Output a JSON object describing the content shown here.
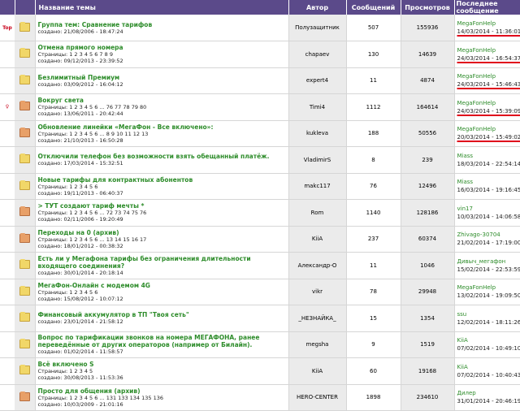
{
  "header": {
    "title": "Название темы",
    "author": "Автор",
    "messages": "Сообщений",
    "views": "Просмотров",
    "last": "Последнее сообщение"
  },
  "rows": [
    {
      "mark": "Top",
      "icon": "folder-special-icon",
      "title": "Группа тем: Сравнение тарифов",
      "pages": "",
      "created": "создано: 21/08/2006 - 18:47:24",
      "author": "Полузащитник",
      "messages": "507",
      "views": "155936",
      "last_user": "MegaFonHelp",
      "last_date": "14/03/2014 - 11:36:01"
    },
    {
      "mark": "",
      "icon": "folder-icon",
      "title": "Отмена прямого номера",
      "pages": "Страницы: 1 2 3 4 5 6 7 8 9",
      "created": "создано: 09/12/2013 - 23:39:52",
      "author": "chapaev",
      "messages": "130",
      "views": "14639",
      "last_user": "MegaFonHelp",
      "last_date": "24/03/2014 - 16:54:37"
    },
    {
      "mark": "",
      "icon": "folder-icon",
      "title": "Безлимитный Премиум",
      "pages": "",
      "created": "создано: 03/09/2012 - 16:04:12",
      "author": "expert4",
      "messages": "11",
      "views": "4874",
      "last_user": "MegaFonHelp",
      "last_date": "24/03/2014 - 15:46:43"
    },
    {
      "mark": "♀",
      "icon": "folder-hot-icon",
      "title": "Вокруг света",
      "pages": "Страницы: 1 2 3 4 5 6 ... 76 77 78 79 80",
      "created": "создано: 13/06/2011 - 20:42:44",
      "author": "Timi4",
      "messages": "1112",
      "views": "164614",
      "last_user": "MegaFonHelp",
      "last_date": "24/03/2014 - 15:39:09"
    },
    {
      "mark": "",
      "icon": "folder-hot-icon",
      "title": "Обновление линейки «МегаФон - Все включено»:",
      "pages": "Страницы: 1 2 3 4 5 6 ... 8 9 10 11 12 13",
      "created": "создано: 21/10/2013 - 16:50:28",
      "author": "kukleva",
      "messages": "188",
      "views": "50556",
      "last_user": "MegaFonHelp",
      "last_date": "20/03/2014 - 15:49:02"
    },
    {
      "mark": "",
      "icon": "folder-icon",
      "title": "Отключили телефон без возможности взять обещанный платёж.",
      "pages": "",
      "created": "создано: 17/03/2014 - 15:32:51",
      "author": "VladimirS",
      "messages": "8",
      "views": "239",
      "last_user": "Miass",
      "last_date": "18/03/2014 - 22:54:14"
    },
    {
      "mark": "",
      "icon": "folder-icon",
      "title": "Новые тарифы для контрактных абонентов",
      "pages": "Страницы: 1 2 3 4 5 6",
      "created": "создано: 19/11/2013 - 06:40:37",
      "author": "makc117",
      "messages": "76",
      "views": "12496",
      "last_user": "Miass",
      "last_date": "16/03/2014 - 19:16:45"
    },
    {
      "mark": "",
      "icon": "folder-hot-icon",
      "title": "> ТУТ создают тариф мечты *",
      "pages": "Страницы: 1 2 3 4 5 6 ... 72 73 74 75 76",
      "created": "создано: 02/11/2006 - 19:20:49",
      "author": "Rom",
      "messages": "1140",
      "views": "128186",
      "last_user": "vin17",
      "last_date": "10/03/2014 - 14:06:58"
    },
    {
      "mark": "",
      "icon": "folder-hot-icon",
      "title": "Переходы на 0 (архив)",
      "pages": "Страницы: 1 2 3 4 5 6 ... 13 14 15 16 17",
      "created": "создано: 18/01/2012 - 00:38:32",
      "author": "KiiA",
      "messages": "237",
      "views": "60374",
      "last_user": "Zhivago-30704",
      "last_date": "21/02/2014 - 17:19:00"
    },
    {
      "mark": "",
      "icon": "folder-icon",
      "title": "Есть ли у Мегафона тарифы без ограничения длительности входящего соединения?",
      "pages": "",
      "created": "создано: 30/01/2014 - 20:18:14",
      "author": "Александр-О",
      "messages": "11",
      "views": "1046",
      "last_user": "Дивыч_мегафон",
      "last_date": "15/02/2014 - 22:53:59"
    },
    {
      "mark": "",
      "icon": "folder-icon",
      "title": "МегаФон-Онлайн с модемом 4G",
      "pages": "Страницы: 1 2 3 4 5 6",
      "created": "создано: 15/08/2012 - 10:07:12",
      "author": "vikr",
      "messages": "78",
      "views": "29948",
      "last_user": "MegaFonHelp",
      "last_date": "13/02/2014 - 19:09:50"
    },
    {
      "mark": "",
      "icon": "folder-icon",
      "title": "Финансовый аккумулятор в ТП \"Твоя сеть\"",
      "pages": "",
      "created": "создано: 23/01/2014 - 21:58:12",
      "author": "_НЕЗНАЙКА_",
      "messages": "15",
      "views": "1354",
      "last_user": "ssu",
      "last_date": "12/02/2014 - 18:11:26"
    },
    {
      "mark": "",
      "icon": "folder-icon",
      "title": "Вопрос по тарификации звонков на номера МЕГАФОНА, ранее переведённые от других операторов (например от Билайн).",
      "pages": "",
      "created": "создано: 01/02/2014 - 11:58:57",
      "author": "megsha",
      "messages": "9",
      "views": "1519",
      "last_user": "KiiA",
      "last_date": "07/02/2014 - 10:49:10"
    },
    {
      "mark": "",
      "icon": "folder-icon",
      "title": "Всё включено S",
      "pages": "Страницы: 1 2 3 4 5",
      "created": "создано: 30/08/2013 - 11:53:36",
      "author": "KiiA",
      "messages": "60",
      "views": "19168",
      "last_user": "KiiA",
      "last_date": "07/02/2014 - 10:40:43"
    },
    {
      "mark": "",
      "icon": "folder-hot-icon",
      "title": "Просто для общения (архив)",
      "pages": "Страницы: 1 2 3 4 5 6 ... 131 133 134 135 136",
      "created": "создано: 10/03/2009 - 21:01:16",
      "author": "HERO-CENTER",
      "messages": "1898",
      "views": "234610",
      "last_user": "Дилер",
      "last_date": "31/01/2014 - 20:46:19"
    }
  ]
}
